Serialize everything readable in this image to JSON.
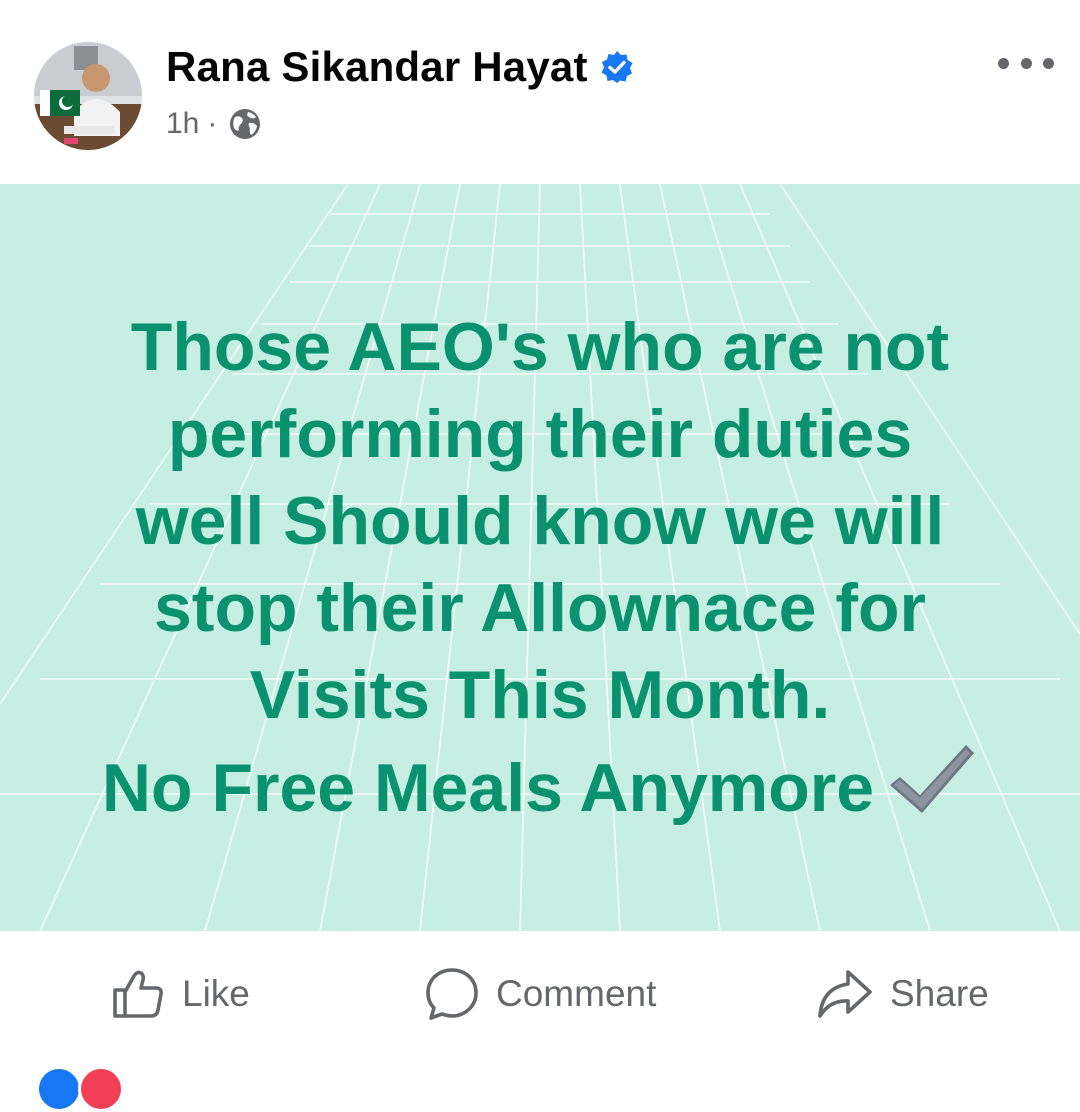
{
  "post": {
    "author": "Rana Sikandar Hayat",
    "time": "1h",
    "separator": "·",
    "icons": {
      "verified": "verified-badge-icon",
      "audience": "globe-icon",
      "menu": "more-options-icon"
    },
    "text_lines": [
      "Those AEO's who are not",
      "performing their duties",
      "well Should know we will",
      "stop their Allownace for",
      "Visits This Month.",
      "No Free Meals Anymore"
    ],
    "emoji": "check-mark-emoji",
    "background_color": "#c6eee2",
    "text_color": "#0a916d"
  },
  "actions": {
    "like": "Like",
    "comment": "Comment",
    "share": "Share"
  },
  "reactions": {
    "icons": [
      "like-reaction-icon",
      "love-reaction-icon"
    ],
    "colors": [
      "#1877f2",
      "#f33e58"
    ]
  },
  "colors": {
    "verified": "#1877f2",
    "secondary_text": "#65676b"
  }
}
